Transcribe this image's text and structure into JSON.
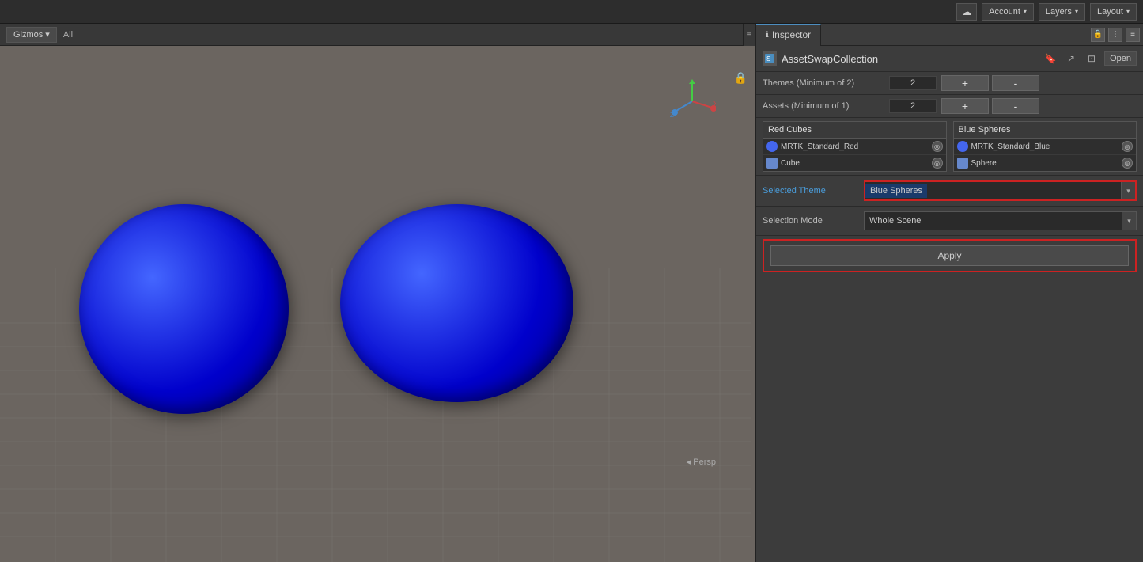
{
  "topbar": {
    "cloud_label": "☁",
    "account_label": "Account",
    "layers_label": "Layers",
    "layout_label": "Layout",
    "arrow": "▾"
  },
  "scene": {
    "gizmos_label": "Gizmos",
    "all_label": "All",
    "persp_label": "◂ Persp"
  },
  "inspector": {
    "tab_label": "Inspector",
    "component_title": "AssetSwapCollection",
    "open_label": "Open",
    "themes_label": "Themes (Minimum of 2)",
    "themes_value": "2",
    "assets_label": "Assets (Minimum of 1)",
    "assets_value": "2",
    "plus_label": "+",
    "minus_label": "-",
    "theme1_header": "Red Cubes",
    "theme1_row1_label": "MRTK_Standard_Red",
    "theme1_row2_label": "Cube",
    "theme2_header": "Blue Spheres",
    "theme2_row1_label": "MRTK_Standard_Blue",
    "theme2_row2_label": "Sphere",
    "selected_theme_label": "Selected Theme",
    "selected_theme_value": "Blue Spheres",
    "selection_mode_label": "Selection Mode",
    "selection_mode_value": "Whole Scene",
    "apply_label": "Apply"
  }
}
